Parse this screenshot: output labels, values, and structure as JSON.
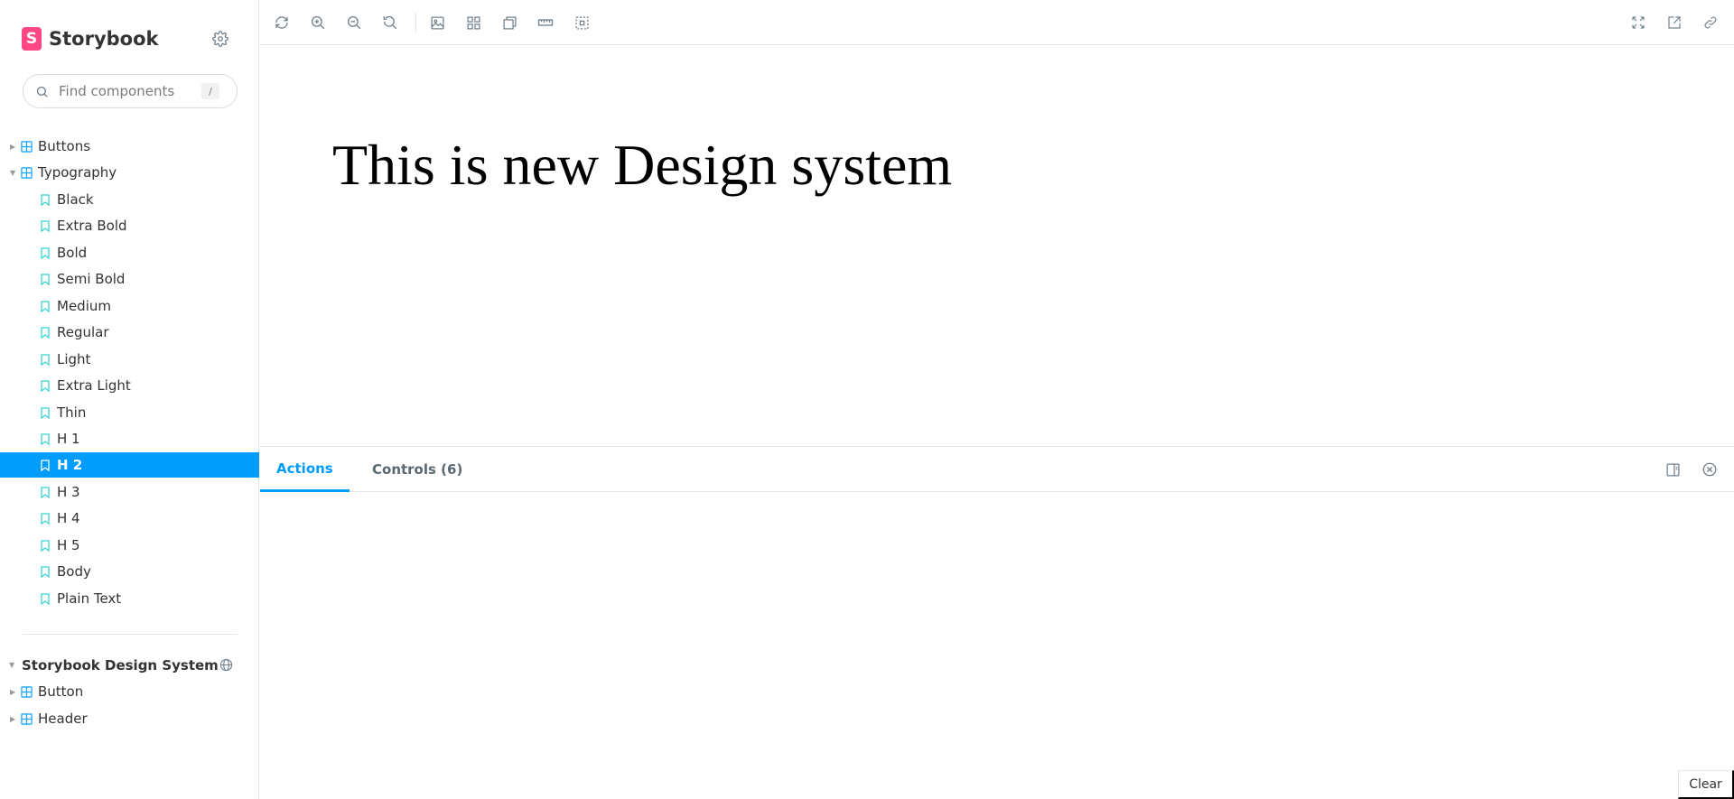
{
  "brand": {
    "name": "Storybook",
    "logo_letter": "S",
    "logo_color": "#ff4785"
  },
  "search": {
    "placeholder": "Find components",
    "shortcut": "/"
  },
  "tree": {
    "groups": [
      {
        "label": "Buttons",
        "expanded": false
      },
      {
        "label": "Typography",
        "expanded": true
      }
    ],
    "stories": [
      "Black",
      "Extra Bold",
      "Bold",
      "Semi Bold",
      "Medium",
      "Regular",
      "Light",
      "Extra Light",
      "Thin",
      "H 1",
      "H 2",
      "H 3",
      "H 4",
      "H 5",
      "Body",
      "Plain Text"
    ],
    "selected_story": "H 2"
  },
  "external_section": {
    "title": "Storybook Design System",
    "items": [
      {
        "label": "Button"
      },
      {
        "label": "Header"
      }
    ]
  },
  "toolbar": {
    "left_icons": [
      "reload-icon",
      "zoom-in-icon",
      "zoom-out-icon",
      "zoom-reset-icon",
      "background-icon",
      "grid-icon",
      "viewport-icon",
      "measure-icon",
      "outline-icon"
    ],
    "right_icons": [
      "fullscreen-icon",
      "open-new-tab-icon",
      "copy-link-icon"
    ]
  },
  "canvas": {
    "heading": "This is new Design system"
  },
  "panel": {
    "tabs": [
      {
        "label": "Actions",
        "active": true
      },
      {
        "label": "Controls (6)",
        "active": false
      }
    ],
    "clear_label": "Clear"
  },
  "colors": {
    "accent": "#029cfd",
    "component_icon": "#1ea7fd",
    "story_icon": "#37d5d3"
  }
}
